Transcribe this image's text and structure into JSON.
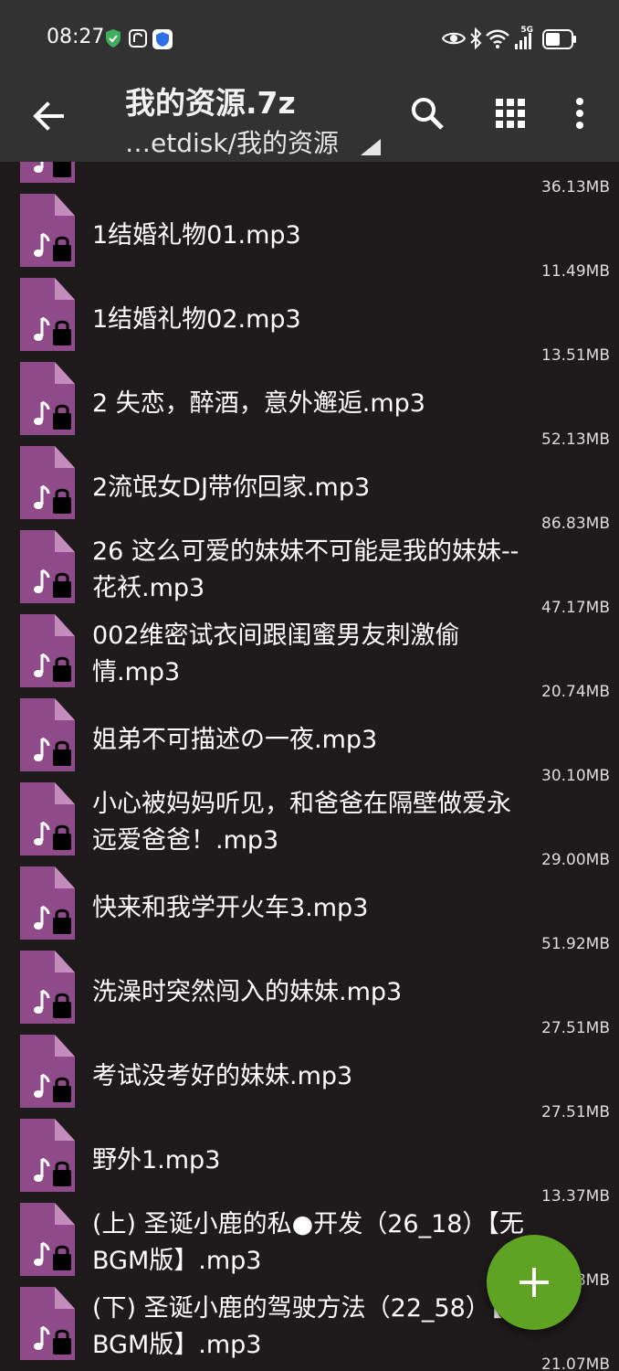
{
  "status_bar": {
    "time": "08:27",
    "network": "5G"
  },
  "header": {
    "title": "我的资源.7z",
    "path": "…etdisk/我的资源"
  },
  "colors": {
    "file_icon": "#8f4a8a",
    "fab": "#5ea322",
    "app_bar": "#323232",
    "background": "#1f1a1b"
  },
  "files": [
    {
      "name": "",
      "size": "36.13MB"
    },
    {
      "name": "1结婚礼物01.mp3",
      "size": "11.49MB"
    },
    {
      "name": "1结婚礼物02.mp3",
      "size": "13.51MB"
    },
    {
      "name": "2 失恋，醉酒，意外邂逅.mp3",
      "size": "52.13MB"
    },
    {
      "name": "2流氓女DJ带你回家.mp3",
      "size": "86.83MB"
    },
    {
      "name": "26 这么可爱的妹妹不可能是我的妹妹--花袄.mp3",
      "size": "47.17MB"
    },
    {
      "name": "002维密试衣间跟闺蜜男友刺激偷情.mp3",
      "size": "20.74MB"
    },
    {
      "name": "姐弟不可描述の一夜.mp3",
      "size": "30.10MB"
    },
    {
      "name": "小心被妈妈听见，和爸爸在隔壁做爱永远爱爸爸！.mp3",
      "size": "29.00MB"
    },
    {
      "name": "快来和我学开火车3.mp3",
      "size": "51.92MB"
    },
    {
      "name": "洗澡时突然闯入的妹妹.mp3",
      "size": "27.51MB"
    },
    {
      "name": "考试没考好的妹妹.mp3",
      "size": "27.51MB"
    },
    {
      "name": "野外1.mp3",
      "size": "13.37MB"
    },
    {
      "name": "(上) 圣诞小鹿的私●开发（26_18）【无BGM版】.mp3",
      "size": "8MB"
    },
    {
      "name": "(下) 圣诞小鹿的驾驶方法（22_58）【无BGM版】.mp3",
      "size": "21.07MB"
    }
  ]
}
